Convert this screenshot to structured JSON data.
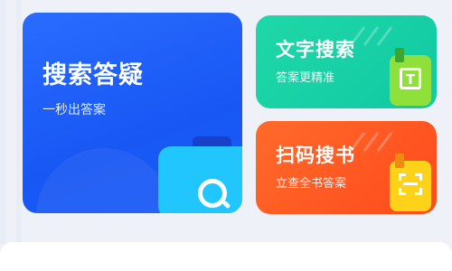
{
  "cards": {
    "photo_search": {
      "title": "搜索答疑",
      "subtitle": "一秒出答案",
      "icon": "camera-search-icon",
      "color": "#1a5cf6"
    },
    "text_search": {
      "title": "文字搜索",
      "subtitle": "答案更精准",
      "icon": "text-document-icon",
      "color": "#11c9a3"
    },
    "code_scan": {
      "title": "扫码搜书",
      "subtitle": "立查全书答案",
      "icon": "scan-book-icon",
      "color": "#ff4a1c"
    }
  }
}
